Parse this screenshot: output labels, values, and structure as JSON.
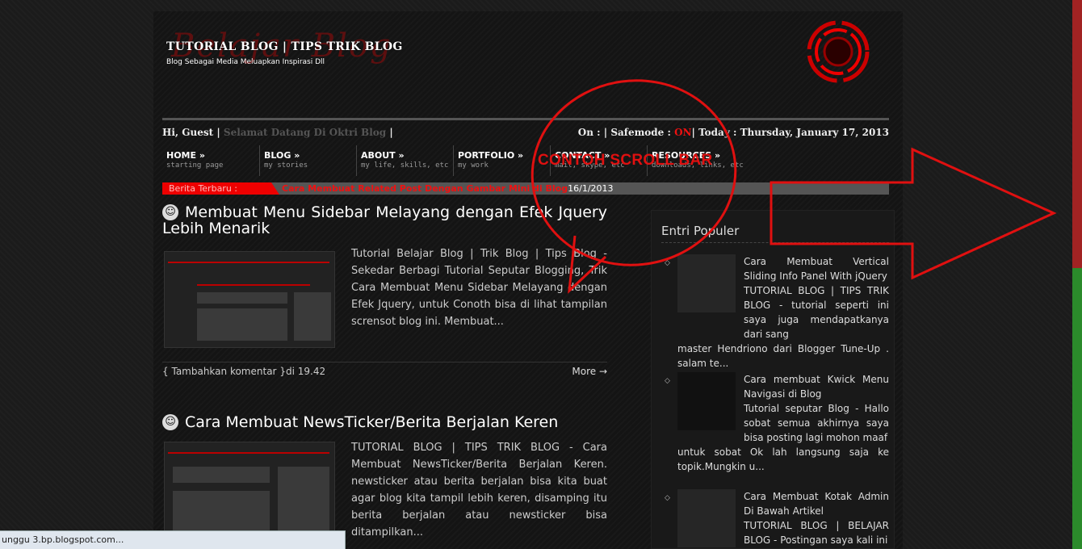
{
  "header": {
    "title": "TUTORIAL BLOG | TIPS TRIK BLOG",
    "description": "Blog Sebagai Media Meluapkan Inspirasi Dll",
    "logo_text": "Belajar Blog"
  },
  "topbar": {
    "greeting": "Hi, Guest",
    "welcome": "Selamat Datang Di Oktri Blog",
    "sep": "|",
    "on_label": "On :",
    "safemode_label": "Safemode :",
    "safemode_value": "ON",
    "today_label": "Today :",
    "today_value": "Thursday, January 17, 2013"
  },
  "nav": [
    {
      "title": "HOME »",
      "sub": "starting page"
    },
    {
      "title": "BLOG »",
      "sub": "my stories"
    },
    {
      "title": "ABOUT »",
      "sub": "my life, skills, etc"
    },
    {
      "title": "PORTFOLIO »",
      "sub": "my work"
    },
    {
      "title": "CONTACT »",
      "sub": "mail, skype, etc"
    },
    {
      "title": "RESOURCES »",
      "sub": "downloads, links, etc"
    }
  ],
  "ticker": {
    "label": "Berita Terbaru :",
    "headline": "Cara Membuat Related Post Dengan Gambar Mini di Blog",
    "date": "16/1/2013"
  },
  "posts": [
    {
      "title": "Membuat Menu Sidebar Melayang dengan Efek Jquery Lebih Menarik",
      "excerpt": "Tutorial Belajar Blog | Trik Blog | Tips Blog - Sekedar Berbagi Tutorial Seputar Blogging, Trik Cara Membuat Menu Sidebar Melayang dengan Efek Jquery, untuk Conoth bisa di lihat tampilan scrensot blog ini. Membuat...",
      "comment": "Tambahkan komentar",
      "time_prefix": "di",
      "time": "19.42",
      "more": "More →",
      "brace_open": "{",
      "brace_close": "}"
    },
    {
      "title": "Cara Membuat NewsTicker/Berita Berjalan Keren",
      "excerpt": "TUTORIAL BLOG | TIPS TRIK BLOG - Cara Membuat NewsTicker/Berita Berjalan Keren. newsticker atau berita berjalan bisa kita buat agar blog kita tampil lebih keren, disamping itu berita berjalan atau newsticker bisa ditampilkan..."
    }
  ],
  "sidebar": {
    "heading": "Entri Populer",
    "items": [
      {
        "title": "Cara Membuat Vertical Sliding Info Panel With jQuery",
        "text": "TUTORIAL BLOG | TIPS TRIK BLOG - tutorial seperti ini saya juga mendapatkanya dari sang",
        "text2": "master Hendriono dari Blogger Tune-Up . salam te..."
      },
      {
        "title": "Cara membuat Kwick Menu Navigasi di Blog",
        "text": "Tutorial seputar Blog - Hallo sobat semua akhirnya saya bisa posting lagi mohon maaf",
        "text2": "untuk sobat Ok lah langsung saja ke topik.Mungkin u..."
      },
      {
        "title": "Cara Membuat Kotak Admin Di Bawah Artikel",
        "text": "TUTORIAL BLOG | BELAJAR BLOG - Postingan saya kali ini",
        "text2": ""
      }
    ]
  },
  "annotation": {
    "label": "CONTOH SCROLL BAR",
    "color": "#e01010"
  },
  "statusbar": {
    "text": "unggu 3.bp.blogspot.com..."
  },
  "colors": {
    "accent": "#e00000",
    "scroll_thumb": "#a12323",
    "scroll_track": "#2b8a2b"
  }
}
